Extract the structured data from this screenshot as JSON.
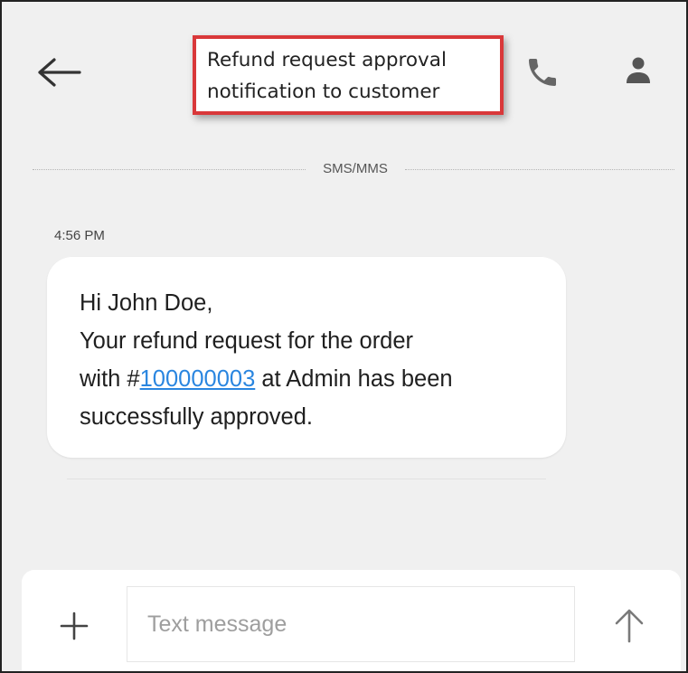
{
  "annotation": {
    "line1": "Refund request approval",
    "line2": "notification to customer",
    "border_color": "#d9383a"
  },
  "header": {
    "back_icon": "arrow-left-icon",
    "call_icon": "phone-icon",
    "contact_icon": "person-icon"
  },
  "conversation": {
    "channel_label": "SMS/MMS",
    "timestamp": "4:56 PM",
    "message": {
      "line1": "Hi John Doe,",
      "line2": "Your refund request for the order",
      "line3_prefix": "with #",
      "order_number": "100000003",
      "line3_suffix": " at Admin has been",
      "line4": "successfully approved."
    }
  },
  "composer": {
    "add_icon": "plus-icon",
    "placeholder": "Text message",
    "value": "",
    "send_icon": "arrow-up-icon"
  },
  "colors": {
    "background": "#f0f0f0",
    "bubble": "#ffffff",
    "link": "#2a86e0",
    "icon": "#333333",
    "icon_muted": "#777777"
  }
}
